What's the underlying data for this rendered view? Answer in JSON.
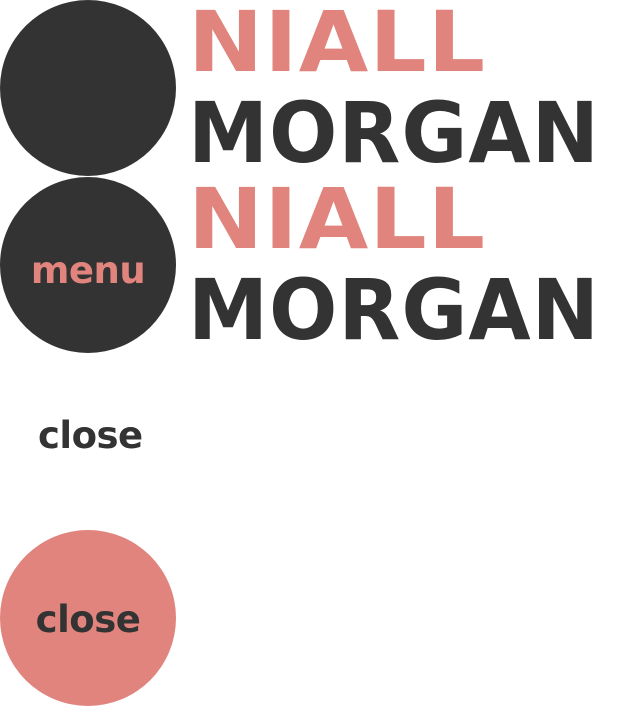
{
  "colors": {
    "accent": "#e0847d",
    "dark": "#333333",
    "background": "#ffffff"
  },
  "brand": {
    "first_name": "NIALL",
    "last_name": "MORGAN"
  },
  "menu_button": {
    "label": "menu"
  },
  "close_link": {
    "label": "close"
  },
  "close_button": {
    "label": "close"
  }
}
